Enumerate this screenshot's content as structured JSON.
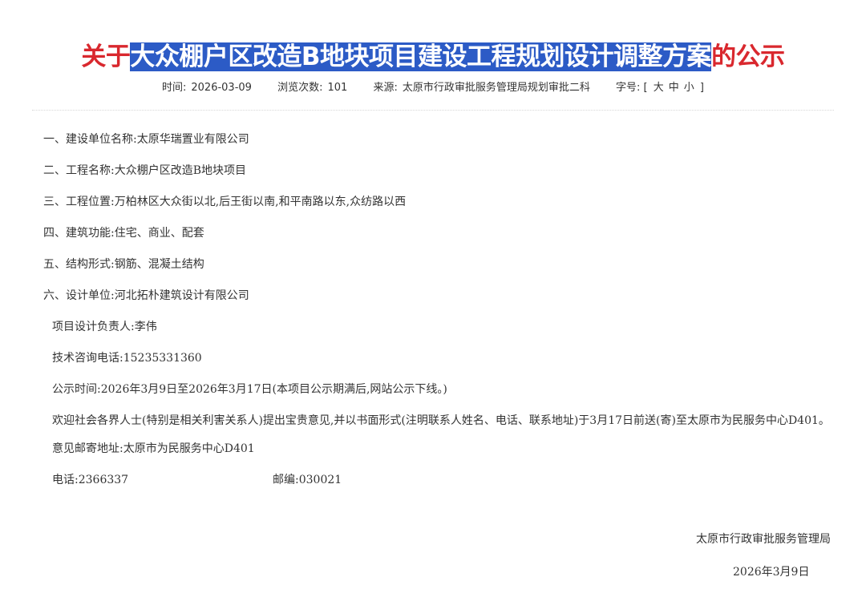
{
  "article": {
    "title_prefix": "关于",
    "title_highlight": "大众棚户区改造B地块项目建设工程规划设计调整方案",
    "title_suffix": "的公示"
  },
  "meta": {
    "time_label": "时间:",
    "time_value": "2026-03-09",
    "views_label": "浏览次数:",
    "views_value": "101",
    "source_label": "来源:",
    "source_value": "太原市行政审批服务管理局规划审批二科",
    "fontsize_label": "字号:",
    "bracket_open": "[",
    "size_large": "大",
    "size_medium": "中",
    "size_small": "小",
    "bracket_close": "]"
  },
  "body": {
    "items": [
      "一、建设单位名称:太原华瑞置业有限公司",
      "二、工程名称:大众棚户区改造B地块项目",
      "三、工程位置:万柏林区大众街以北,后王街以南,和平南路以东,众纺路以西",
      "四、建筑功能:住宅、商业、配套",
      "五、结构形式:钢筋、混凝土结构",
      "六、设计单位:河北拓朴建筑设计有限公司"
    ],
    "designer": "项目设计负责人:李伟",
    "phone": "技术咨询电话:15235331360",
    "period": "公示时间:2026年3月9日至2026年3月17日(本项目公示期满后,网站公示下线。)",
    "invite": "欢迎社会各界人士(特别是相关利害关系人)提出宝贵意见,并以书面形式(注明联系人姓名、电话、联系地址)于3月17日前送(寄)至太原市为民服务中心D401。",
    "mail_address": "意见邮寄地址:太原市为民服务中心D401",
    "tel": "电话:2366337",
    "postcode": "邮编:030021"
  },
  "signature": {
    "org": "太原市行政审批服务管理局",
    "date": "2026年3月9日"
  },
  "colors": {
    "title": "#d9282e",
    "highlight_bg": "#2c5bc6",
    "text": "#333333"
  }
}
